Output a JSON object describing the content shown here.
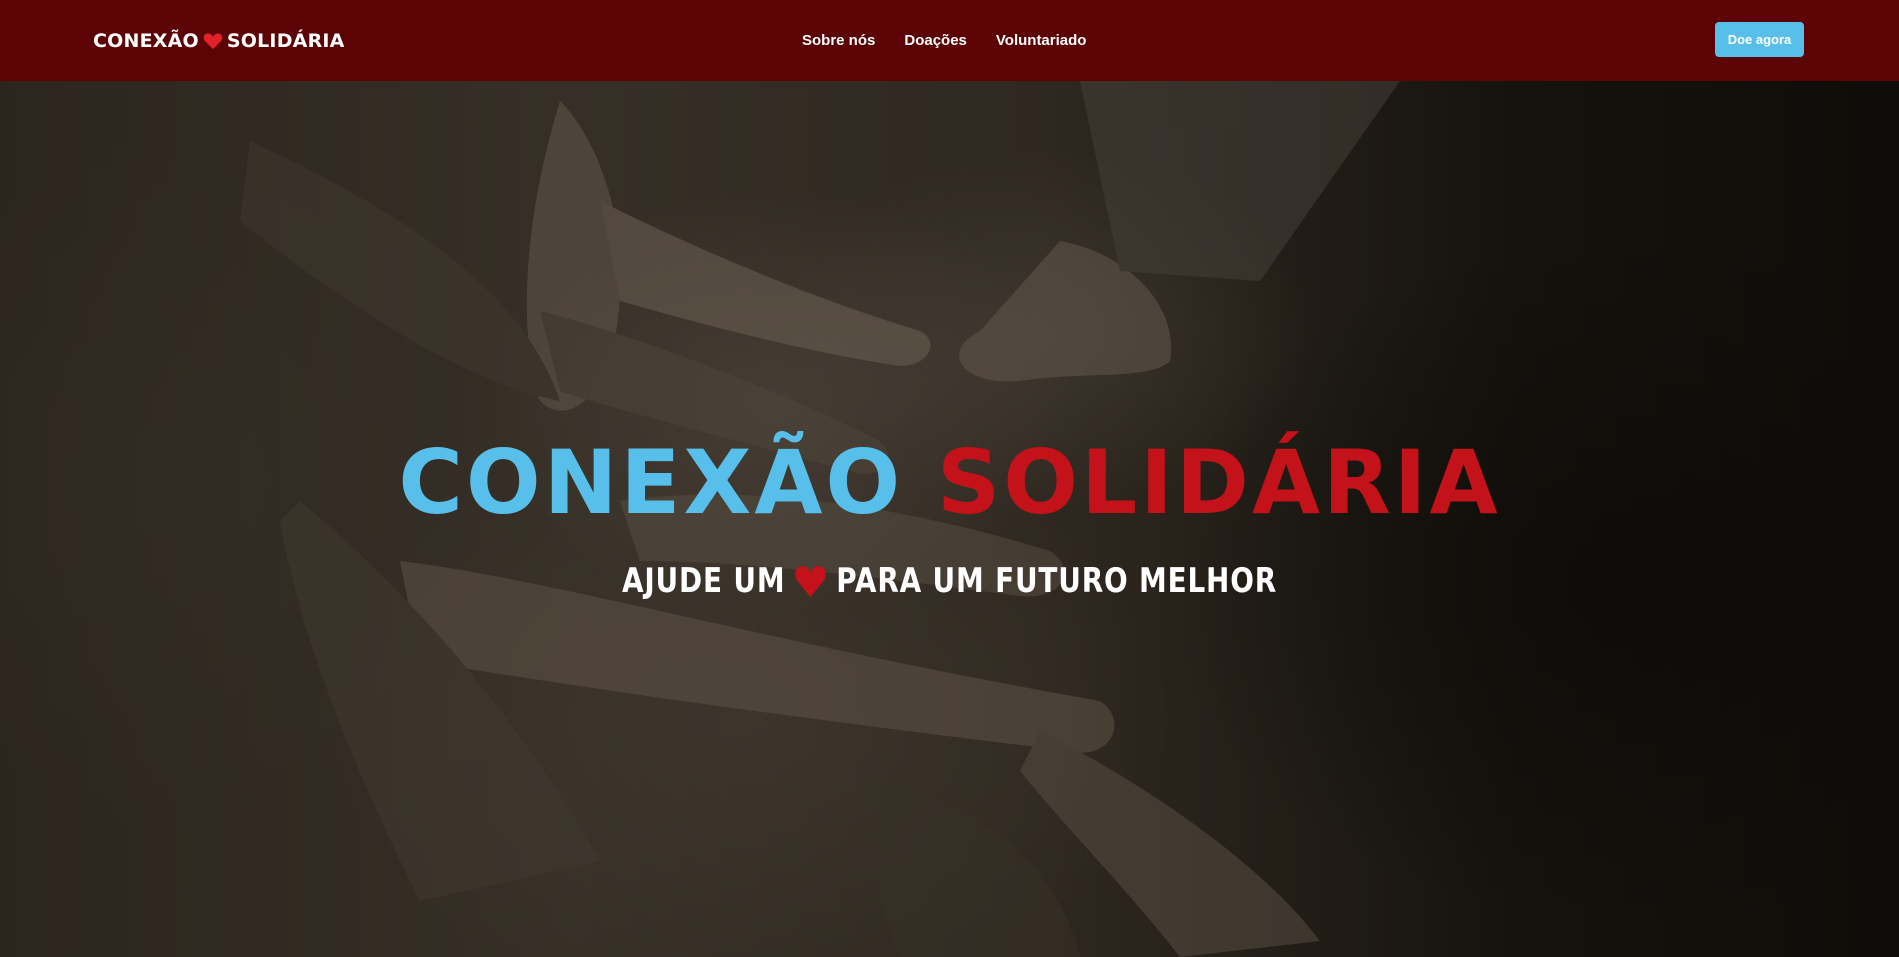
{
  "navbar": {
    "brand_left": "CONEXÃO",
    "brand_right": "SOLIDÁRIA",
    "brand_icon": "heart-icon",
    "links": [
      "Sobre nós",
      "Doações",
      "Voluntariado"
    ],
    "cta_label": "Doe agora"
  },
  "hero": {
    "title_left": "CONEXÃO",
    "title_right": "SOLIDÁRIA",
    "subtitle_before": "AJUDE UM",
    "subtitle_icon": "heart-icon",
    "subtitle_after": "PARA UM FUTURO MELHOR"
  },
  "colors": {
    "navbar_bg": "#5c0405",
    "accent_blue": "#58bfea",
    "accent_red": "#c4121a",
    "cta_bg": "#58bfea"
  }
}
